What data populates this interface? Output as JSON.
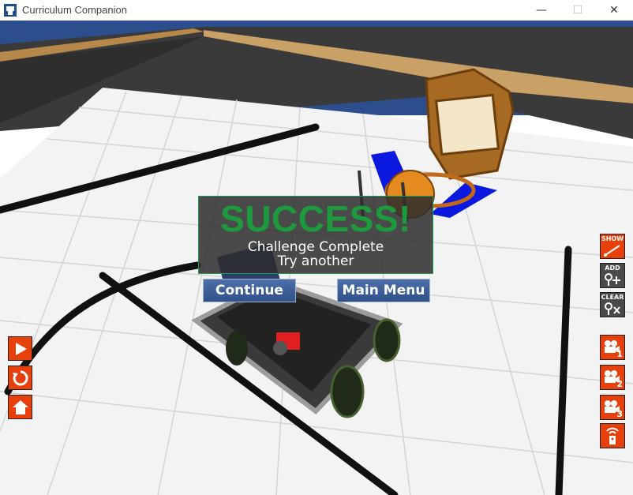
{
  "window": {
    "title": "Curriculum Companion",
    "minimize_glyph": "—",
    "maximize_glyph": "☐",
    "close_glyph": "✕"
  },
  "dialog": {
    "heading": "SUCCESS!",
    "line1": "Challenge Complete",
    "line2": "Try another",
    "continue_label": "Continue",
    "main_menu_label": "Main Menu",
    "accent_color": "#1e9a3e"
  },
  "left_toolbar": {
    "items": [
      "play-icon",
      "reset-icon",
      "home-icon"
    ]
  },
  "right_toolbar": {
    "show_label": "SHOW",
    "add_label": "ADD",
    "clear_label": "CLEAR",
    "camera_1": "1",
    "camera_2": "2",
    "camera_3": "3",
    "accent_color": "#e8400c"
  }
}
